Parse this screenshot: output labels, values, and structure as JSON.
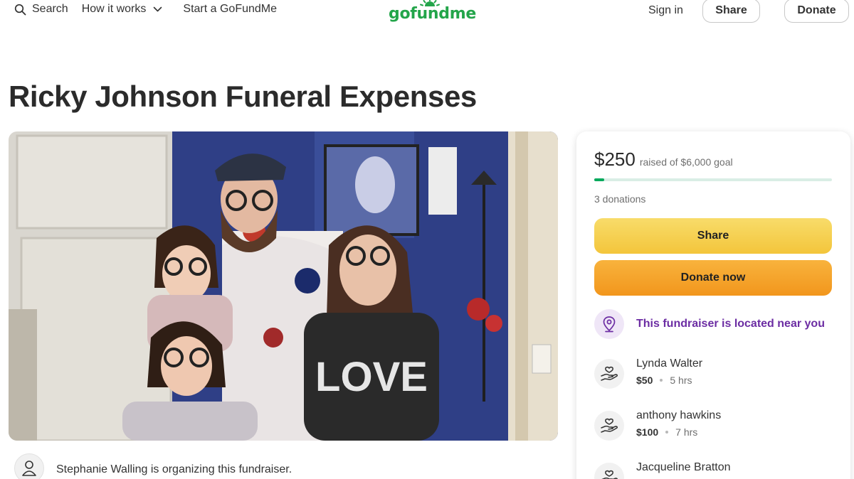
{
  "header": {
    "search_label": "Search",
    "how_it_works_label": "How it works",
    "start_label": "Start a GoFundMe",
    "logo_text": "gofundme",
    "sign_in_label": "Sign in",
    "share_label": "Share",
    "donate_label": "Donate",
    "brand_color": "#23a54a"
  },
  "campaign": {
    "title": "Ricky Johnson Funeral Expenses",
    "photo_caption_text": "LOVE",
    "organizer_text": "Stephanie Walling is organizing this fundraiser."
  },
  "sidebar": {
    "raised_amount": "$250",
    "goal_text": "raised of $6,000 goal",
    "progress_fraction": 0.0417,
    "donations_count": "3 donations",
    "share_button": "Share",
    "donate_button": "Donate now",
    "nearby_text": "This fundraiser is located near you",
    "accent_purple": "#6c2da3",
    "donations": [
      {
        "name": "Lynda Walter",
        "amount": "$50",
        "time": "5 hrs"
      },
      {
        "name": "anthony hawkins",
        "amount": "$100",
        "time": "7 hrs"
      },
      {
        "name": "Jacqueline Bratton",
        "amount": "",
        "time": ""
      }
    ]
  }
}
